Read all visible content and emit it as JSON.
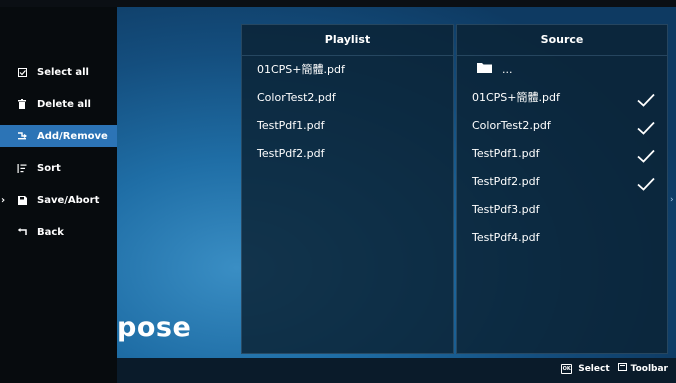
{
  "menu": {
    "items": [
      {
        "label": "Select all",
        "icon": "checkbox-icon"
      },
      {
        "label": "Delete all",
        "icon": "trash-icon"
      },
      {
        "label": "Add/Remove",
        "icon": "add-remove-icon",
        "active": true
      },
      {
        "label": "Sort",
        "icon": "sort-icon"
      },
      {
        "label": "Save/Abort",
        "icon": "save-icon",
        "has_submenu": true
      },
      {
        "label": "Back",
        "icon": "back-icon"
      }
    ]
  },
  "background": {
    "partial_title": "pose"
  },
  "playlist": {
    "header": "Playlist",
    "files": [
      "01CPS+簡體.pdf",
      "ColorTest2.pdf",
      "TestPdf1.pdf",
      "TestPdf2.pdf"
    ]
  },
  "source": {
    "header": "Source",
    "folder_label": "...",
    "files": [
      {
        "name": "01CPS+簡體.pdf",
        "checked": true
      },
      {
        "name": "ColorTest2.pdf",
        "checked": true
      },
      {
        "name": "TestPdf1.pdf",
        "checked": true
      },
      {
        "name": "TestPdf2.pdf",
        "checked": true
      },
      {
        "name": "TestPdf3.pdf",
        "checked": false
      },
      {
        "name": "TestPdf4.pdf",
        "checked": false
      }
    ]
  },
  "hints": {
    "select_key": "OK",
    "select": "Select",
    "toolbar": "Toolbar"
  },
  "colors": {
    "accent": "#2c74b6",
    "panel": "#0b2334",
    "sidebar": "#070b0e"
  }
}
